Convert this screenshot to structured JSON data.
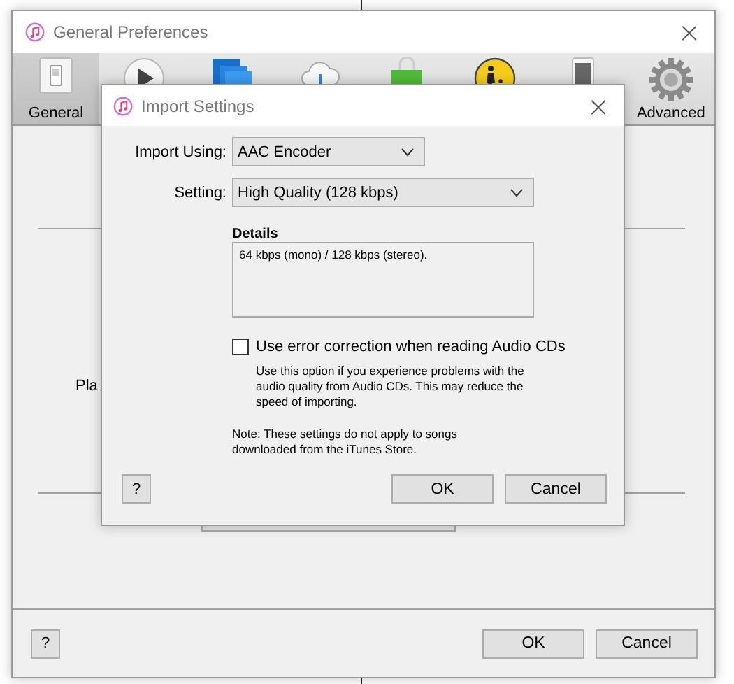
{
  "main_window": {
    "title": "General Preferences",
    "close": "×",
    "toolbar": [
      {
        "kind": "general",
        "label": "General",
        "selected": true
      },
      {
        "kind": "playback",
        "selected": false
      },
      {
        "kind": "sharing",
        "selected": false
      },
      {
        "kind": "store",
        "selected": false
      },
      {
        "kind": "bag",
        "selected": false
      },
      {
        "kind": "parental",
        "selected": false
      },
      {
        "kind": "devices",
        "selected": false
      },
      {
        "kind": "advanced",
        "label": "Advanced",
        "selected": false
      }
    ],
    "partial_label": "Pla",
    "help": "?",
    "buttons": [
      "OK",
      "Cancel"
    ]
  },
  "dialog": {
    "title": "Import Settings",
    "close": "×",
    "import_using": {
      "label": "Import Using:",
      "value": "AAC Encoder"
    },
    "setting": {
      "label": "Setting:",
      "value": "High Quality (128 kbps)"
    },
    "details": {
      "label": "Details",
      "text": "64 kbps (mono) / 128 kbps (stereo)."
    },
    "error_correction": {
      "label": "Use error correction when reading Audio CDs",
      "checked": false,
      "hint": "Use this option if you experience problems with the audio quality from Audio CDs. This may reduce the speed of importing."
    },
    "note": "Note: These settings do not apply to songs downloaded from the iTunes Store.",
    "help": "?",
    "buttons": [
      "OK",
      "Cancel"
    ]
  }
}
